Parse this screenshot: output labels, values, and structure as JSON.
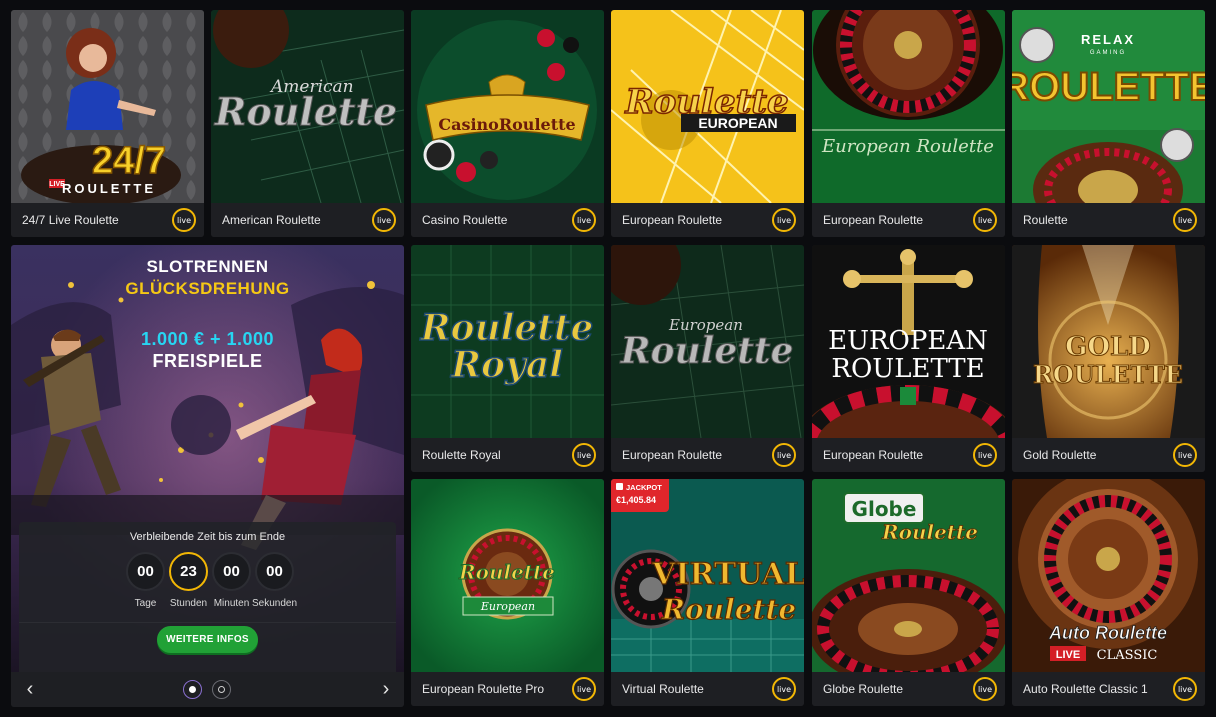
{
  "games": [
    {
      "name": "24/7 Live Roulette",
      "badge": "live",
      "art_text": [
        "24/7",
        "LIVE",
        "ROULETTE"
      ]
    },
    {
      "name": "American Roulette",
      "badge": "live",
      "art_text": [
        "American",
        "Roulette"
      ]
    },
    {
      "name": "Casino Roulette",
      "badge": "live",
      "art_text": [
        "CasinoRoulette"
      ]
    },
    {
      "name": "European Roulette",
      "badge": "live",
      "art_text": [
        "Roulette",
        "EUROPEAN"
      ]
    },
    {
      "name": "European Roulette",
      "badge": "live",
      "art_text": [
        "European Roulette"
      ]
    },
    {
      "name": "Roulette",
      "badge": "live",
      "art_text": [
        "RELAX",
        "GAMING",
        "ROULETTE"
      ]
    },
    {
      "name": "Roulette Royal",
      "badge": "live",
      "art_text": [
        "Roulette",
        "Royal"
      ]
    },
    {
      "name": "European Roulette",
      "badge": "live",
      "art_text": [
        "European",
        "Roulette"
      ]
    },
    {
      "name": "European Roulette",
      "badge": "live",
      "art_text": [
        "EUROPEAN",
        "ROULETTE"
      ]
    },
    {
      "name": "Gold Roulette",
      "badge": "live",
      "art_text": [
        "GOLD",
        "ROULETTE"
      ]
    },
    {
      "name": "European Roulette Pro",
      "badge": "live",
      "art_text": [
        "Roulette",
        "European"
      ]
    },
    {
      "name": "Virtual Roulette",
      "badge": "live",
      "art_text": [
        "VIRTUAL",
        "Roulette"
      ],
      "jackpot": {
        "label": "JACKPOT",
        "value": "€1,405.84"
      }
    },
    {
      "name": "Globe Roulette",
      "badge": "live",
      "art_text": [
        "Globe",
        "Roulette"
      ]
    },
    {
      "name": "Auto Roulette Classic 1",
      "badge": "live",
      "art_text": [
        "Auto Roulette",
        "LIVE",
        "CLASSIC"
      ]
    }
  ],
  "promo": {
    "line1": "SLOTRENNEN",
    "line2": "GLÜCKSDREHUNG",
    "line3": "1.000 € + 1.000",
    "line4": "FREISPIELE",
    "countdown_title": "Verbleibende Zeit bis zum Ende",
    "units": [
      {
        "value": "00",
        "label": "Tage"
      },
      {
        "value": "23",
        "label": "Stunden"
      },
      {
        "value": "00",
        "label": "Minuten"
      },
      {
        "value": "00",
        "label": "Sekunden"
      }
    ],
    "button": "WEITERE INFOS",
    "prev": "‹",
    "next": "›"
  },
  "colors": {
    "accent": "#f2b705",
    "button": "#21a136",
    "jackpot": "#e0262b"
  }
}
